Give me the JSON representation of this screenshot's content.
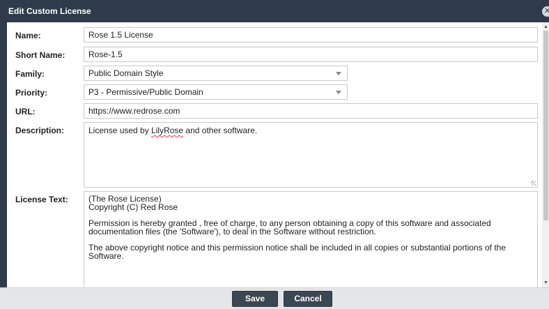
{
  "dialog": {
    "title": "Edit Custom License"
  },
  "form": {
    "name": {
      "label": "Name:",
      "value": "Rose 1.5 License"
    },
    "short_name": {
      "label": "Short Name:",
      "value": "Rose-1.5"
    },
    "family": {
      "label": "Family:",
      "value": "Public Domain Style"
    },
    "priority": {
      "label": "Priority:",
      "value": "P3 - Permissive/Public Domain"
    },
    "url": {
      "label": "URL:",
      "value": "https://www.redrose.com"
    },
    "description": {
      "label": "Description:",
      "before": "License used by ",
      "misspelled": "LilyRose",
      "after": " and other software."
    },
    "license_text": {
      "label": "License Text:",
      "lines": [
        "(The Rose License)",
        "Copyright (C) Red Rose",
        "",
        "Permission is hereby granted , free of charge, to any person obtaining a copy of this software and associated",
        "documentation files (the 'Software'),  to deal in the Software without restriction.",
        "",
        "The above copyright notice and this permission notice shall be included in all copies or substantial portions of the",
        "Software."
      ]
    }
  },
  "footer": {
    "save_label": "Save",
    "cancel_label": "Cancel"
  },
  "icons": {
    "close": "close-icon",
    "dropdown": "chevron-down-icon",
    "scroll_up": "scroll-up-icon",
    "scroll_down": "scroll-down-icon"
  },
  "colors": {
    "titlebar": "#2f3b4a",
    "button": "#3c4754",
    "footer": "#e4e6e9",
    "misspelling": "#d33333"
  }
}
